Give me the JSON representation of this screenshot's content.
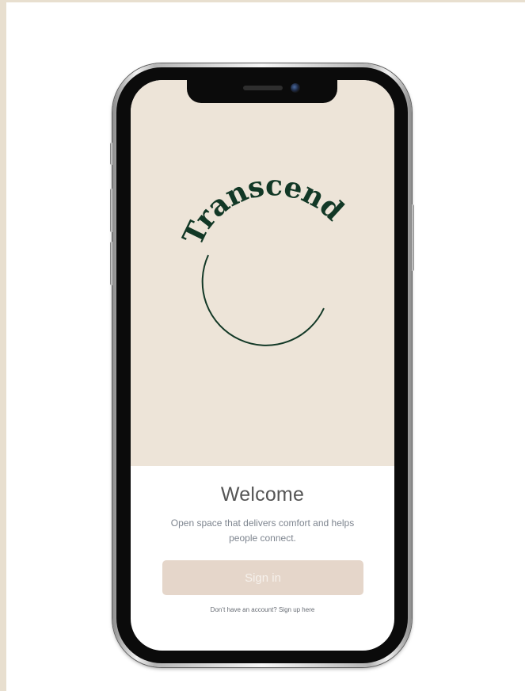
{
  "brand": {
    "logo_text": "Transcend",
    "logo_color": "#123826",
    "hero_bg": "#ede4d8"
  },
  "welcome": {
    "title": "Welcome",
    "subtitle_line1": "Open space that delivers comfort and helps",
    "subtitle_line2": "people connect."
  },
  "actions": {
    "signin_label": "Sign in",
    "signup_text": "Don’t have an account? Sign up here"
  },
  "colors": {
    "button_bg": "#e5d6ca",
    "button_text": "#f6f1ec",
    "page_accent": "#e8dfcf"
  }
}
